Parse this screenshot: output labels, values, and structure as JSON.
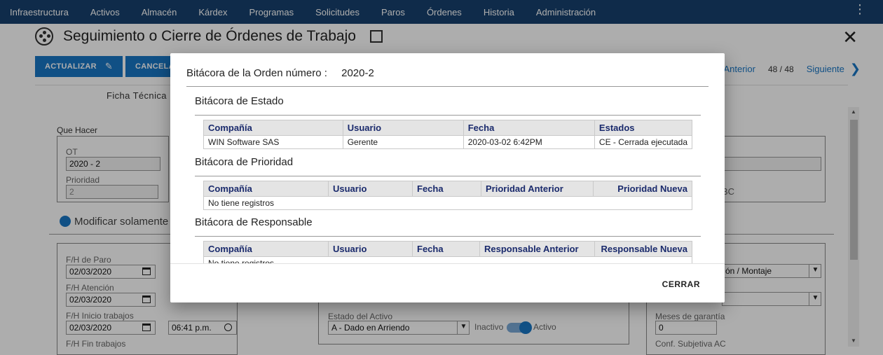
{
  "nav": [
    "Infraestructura",
    "Activos",
    "Almacén",
    "Kárdex",
    "Programas",
    "Solicitudes",
    "Paros",
    "Órdenes",
    "Historia",
    "Administración"
  ],
  "page_title": "Seguimiento o Cierre de Órdenes de Trabajo",
  "toolbar": {
    "update_label": "ACTUALIZAR",
    "cancel_label": "CANCELA"
  },
  "pager": {
    "previous": "Anterior",
    "count": "48 / 48",
    "next": "Siguiente"
  },
  "tab_label": "Ficha Técnica",
  "form": {
    "que_hacer": "Que Hacer",
    "ot_label": "OT",
    "ot_value": "2020 - 2",
    "prioridad_label": "Prioridad",
    "prioridad_value": "2",
    "modificar_label": "Modificar solamente",
    "fh_paro_label": "F/H de Paro",
    "fh_paro_value": "02/03/2020",
    "fh_atencion_label": "F/H Atención",
    "fh_atencion_value": "02/03/2020",
    "fh_inicio_label": "F/H Inicio trabajos",
    "fh_inicio_value": "02/03/2020",
    "fh_inicio_time": "06:41 p.m.",
    "fh_fin_label": "F/H Fin trabajos",
    "estado_activo_label": "Estado del Activo",
    "estado_activo_value": "A - Dado en Arriendo",
    "inactivo_label": "Inactivo",
    "activo_label": "Activo",
    "montaje_value": "ón / Montaje",
    "meses_garantia_label": "Meses de garantía",
    "meses_garantia_value": "0",
    "conf_subjetiva_label": "Conf. Subjetiva AC",
    "partial_text": "BC"
  },
  "modal": {
    "header_label": "Bitácora de la Orden número :",
    "order_number": "2020-2",
    "close_label": "CERRAR",
    "estado": {
      "title": "Bitácora de Estado",
      "columns": [
        "Compañía",
        "Usuario",
        "Fecha",
        "Estados"
      ],
      "rows": [
        [
          "WIN Software SAS",
          "Gerente",
          "2020-03-02 6:42PM",
          "CE - Cerrada ejecutada"
        ]
      ]
    },
    "prioridad": {
      "title": "Bitácora de Prioridad",
      "columns": [
        "Compañía",
        "Usuario",
        "Fecha",
        "Prioridad Anterior",
        "Prioridad Nueva"
      ],
      "empty": "No tiene registros"
    },
    "responsable": {
      "title": "Bitácora de Responsable",
      "columns": [
        "Compañía",
        "Usuario",
        "Fecha",
        "Responsable Anterior",
        "Responsable Nueva"
      ],
      "empty": "No tiene registros"
    }
  }
}
